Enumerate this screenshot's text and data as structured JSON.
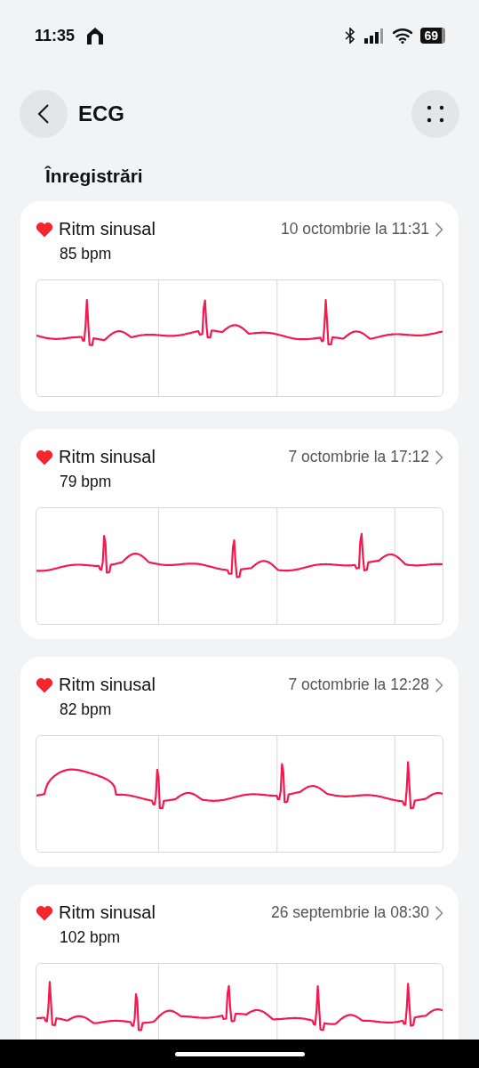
{
  "status_bar": {
    "time": "11:35",
    "battery": "69"
  },
  "header": {
    "title": "ECG"
  },
  "section": {
    "title": "Înregistrări"
  },
  "recordings": [
    {
      "rhythm": "Ritm sinusal",
      "date": "10 octombrie la 11:31",
      "heart_rate": "85 bpm"
    },
    {
      "rhythm": "Ritm sinusal",
      "date": "7 octombrie la 17:12",
      "heart_rate": "79 bpm"
    },
    {
      "rhythm": "Ritm sinusal",
      "date": "7 octombrie la 12:28",
      "heart_rate": "82 bpm"
    },
    {
      "rhythm": "Ritm sinusal",
      "date": "26 septembrie la 08:30",
      "heart_rate": "102 bpm"
    }
  ]
}
